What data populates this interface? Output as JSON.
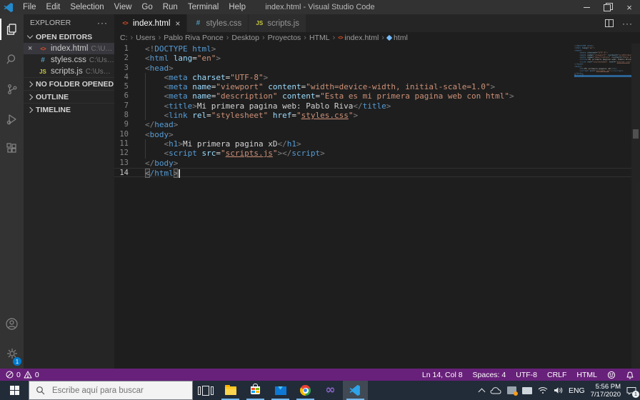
{
  "window": {
    "title": "index.html - Visual Studio Code"
  },
  "menu": {
    "items": [
      "File",
      "Edit",
      "Selection",
      "View",
      "Go",
      "Run",
      "Terminal",
      "Help"
    ]
  },
  "activity_bar": {
    "icons": [
      "explorer-icon",
      "search-icon",
      "source-control-icon",
      "run-debug-icon",
      "extensions-icon",
      "account-icon",
      "settings-gear-icon"
    ],
    "active": "explorer-icon",
    "settings_badge": "1"
  },
  "sidebar": {
    "header": "EXPLORER",
    "more_label": "···",
    "open_editors_label": "OPEN EDITORS",
    "open_editors": [
      {
        "icon": "html",
        "label": "index.html",
        "detail": "C:\\User...",
        "active": true,
        "close": "×"
      },
      {
        "icon": "css",
        "label": "styles.css",
        "detail": "C:\\Users\\..."
      },
      {
        "icon": "js",
        "label": "scripts.js",
        "detail": "C:\\Users\\..."
      }
    ],
    "sections": [
      "NO FOLDER OPENED",
      "OUTLINE",
      "TIMELINE"
    ]
  },
  "tabs": [
    {
      "icon": "html",
      "label": "index.html",
      "active": true,
      "close": "×"
    },
    {
      "icon": "css",
      "label": "styles.css"
    },
    {
      "icon": "js",
      "label": "scripts.js"
    }
  ],
  "breadcrumb": [
    {
      "label": "C:"
    },
    {
      "label": "Users"
    },
    {
      "label": "Pablo Riva Ponce"
    },
    {
      "label": "Desktop"
    },
    {
      "label": "Proyectos"
    },
    {
      "label": "HTML"
    },
    {
      "label": "index.html",
      "icon": "html"
    },
    {
      "label": "html",
      "icon": "symbol"
    }
  ],
  "editor": {
    "lines": [
      {
        "tokens": [
          [
            "p",
            "<!"
          ],
          [
            "t",
            "DOCTYPE"
          ],
          [
            "x",
            " "
          ],
          [
            "t",
            "html"
          ],
          [
            "p",
            ">"
          ]
        ]
      },
      {
        "tokens": [
          [
            "p",
            "<"
          ],
          [
            "t",
            "html"
          ],
          [
            "x",
            " "
          ],
          [
            "a",
            "lang"
          ],
          [
            "o",
            "="
          ],
          [
            "s",
            "\"en\""
          ],
          [
            "p",
            ">"
          ]
        ]
      },
      {
        "tokens": [
          [
            "p",
            "<"
          ],
          [
            "t",
            "head"
          ],
          [
            "p",
            ">"
          ]
        ]
      },
      {
        "indent": true,
        "tokens": [
          [
            "w",
            "    "
          ],
          [
            "p",
            "<"
          ],
          [
            "t",
            "meta"
          ],
          [
            "x",
            " "
          ],
          [
            "a",
            "charset"
          ],
          [
            "o",
            "="
          ],
          [
            "s",
            "\"UTF-8\""
          ],
          [
            "p",
            ">"
          ]
        ]
      },
      {
        "indent": true,
        "tokens": [
          [
            "w",
            "    "
          ],
          [
            "p",
            "<"
          ],
          [
            "t",
            "meta"
          ],
          [
            "x",
            " "
          ],
          [
            "a",
            "name"
          ],
          [
            "o",
            "="
          ],
          [
            "s",
            "\"viewport\""
          ],
          [
            "x",
            " "
          ],
          [
            "a",
            "content"
          ],
          [
            "o",
            "="
          ],
          [
            "s",
            "\"width=device-width, initial-scale=1.0\""
          ],
          [
            "p",
            ">"
          ]
        ]
      },
      {
        "indent": true,
        "tokens": [
          [
            "w",
            "    "
          ],
          [
            "p",
            "<"
          ],
          [
            "t",
            "meta"
          ],
          [
            "x",
            " "
          ],
          [
            "a",
            "name"
          ],
          [
            "o",
            "="
          ],
          [
            "s",
            "\"description\""
          ],
          [
            "x",
            " "
          ],
          [
            "a",
            "content"
          ],
          [
            "o",
            "="
          ],
          [
            "s",
            "\"Esta es mi primera pagina web con html\""
          ],
          [
            "p",
            ">"
          ]
        ]
      },
      {
        "indent": true,
        "tokens": [
          [
            "w",
            "    "
          ],
          [
            "p",
            "<"
          ],
          [
            "t",
            "title"
          ],
          [
            "p",
            ">"
          ],
          [
            "x",
            "Mi primera pagina web: Pablo Riva"
          ],
          [
            "p",
            "</"
          ],
          [
            "t",
            "title"
          ],
          [
            "p",
            ">"
          ]
        ]
      },
      {
        "indent": true,
        "tokens": [
          [
            "w",
            "    "
          ],
          [
            "p",
            "<"
          ],
          [
            "t",
            "link"
          ],
          [
            "x",
            " "
          ],
          [
            "a",
            "rel"
          ],
          [
            "o",
            "="
          ],
          [
            "s",
            "\"stylesheet\""
          ],
          [
            "x",
            " "
          ],
          [
            "a",
            "href"
          ],
          [
            "o",
            "="
          ],
          [
            "s",
            "\""
          ],
          [
            "u",
            "styles.css"
          ],
          [
            "s",
            "\""
          ],
          [
            "p",
            ">"
          ]
        ]
      },
      {
        "tokens": [
          [
            "p",
            "</"
          ],
          [
            "t",
            "head"
          ],
          [
            "p",
            ">"
          ]
        ]
      },
      {
        "tokens": [
          [
            "p",
            "<"
          ],
          [
            "t",
            "body"
          ],
          [
            "p",
            ">"
          ]
        ]
      },
      {
        "indent": true,
        "tokens": [
          [
            "w",
            "    "
          ],
          [
            "p",
            "<"
          ],
          [
            "t",
            "h1"
          ],
          [
            "p",
            ">"
          ],
          [
            "x",
            "Mi primera pagina xD"
          ],
          [
            "p",
            "</"
          ],
          [
            "t",
            "h1"
          ],
          [
            "p",
            ">"
          ]
        ]
      },
      {
        "indent": true,
        "tokens": [
          [
            "w",
            "    "
          ],
          [
            "p",
            "<"
          ],
          [
            "t",
            "script"
          ],
          [
            "x",
            " "
          ],
          [
            "a",
            "src"
          ],
          [
            "o",
            "="
          ],
          [
            "s",
            "\""
          ],
          [
            "u",
            "scripts.js"
          ],
          [
            "s",
            "\""
          ],
          [
            "p",
            ">"
          ],
          [
            "p",
            "</"
          ],
          [
            "t",
            "script"
          ],
          [
            "p",
            ">"
          ]
        ]
      },
      {
        "tokens": [
          [
            "p",
            "</"
          ],
          [
            "t",
            "body"
          ],
          [
            "p",
            ">"
          ]
        ]
      },
      {
        "current": true,
        "cursor": true,
        "tokens": [
          [
            "b",
            "<"
          ],
          [
            "t",
            "/html"
          ],
          [
            "b",
            ">"
          ]
        ]
      }
    ]
  },
  "status_bar": {
    "errors": "0",
    "warnings": "0",
    "items": [
      "Ln 14, Col 8",
      "Spaces: 4",
      "UTF-8",
      "CRLF",
      "HTML"
    ]
  },
  "taskbar": {
    "search_placeholder": "Escribe aquí para buscar",
    "apps": [
      "task-view",
      "file-explorer",
      "store",
      "mail",
      "chrome",
      "visual-studio",
      "vscode"
    ],
    "language": "ENG",
    "time": "5:56 PM",
    "date": "7/17/2020",
    "notification_count": "1"
  },
  "colors": {
    "status_bar": "#68217a",
    "accent_blue": "#007acc",
    "editor_bg": "#1e1e1e",
    "taskbar_bg": "#222c39"
  }
}
